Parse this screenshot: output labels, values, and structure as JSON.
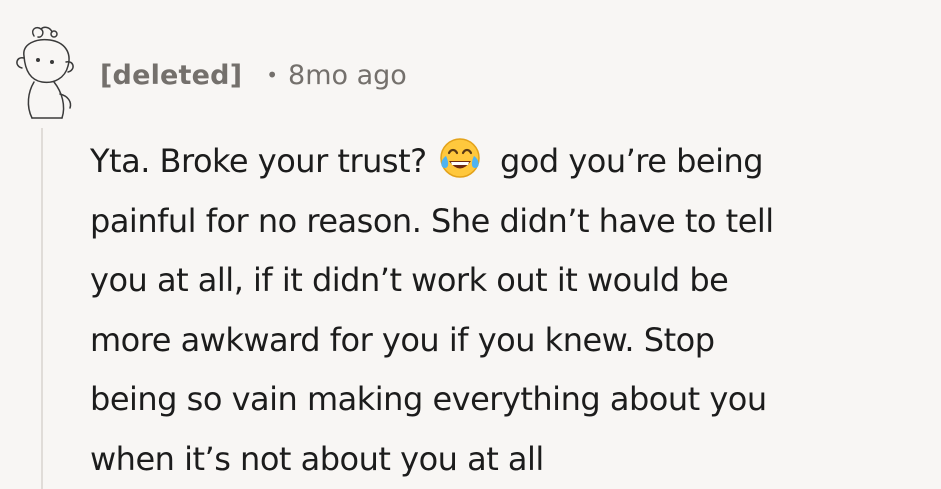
{
  "comment": {
    "author": "[deleted]",
    "separator": "•",
    "time_ago": "8mo ago",
    "body_lines": [
      "Yta. Broke your trust? ",
      " god you’re being",
      "painful for no reason. She didn’t have to tell",
      "you at all, if it didn’t work out it would be",
      "more awkward for you if you knew. Stop",
      "being so vain making everything about you",
      "when it’s not about you at all"
    ],
    "inline_emoji": "face-with-tears-of-joy-icon"
  },
  "colors": {
    "background": "#f8f6f4",
    "meta_text": "#74706c",
    "body_text": "#1c1c1c",
    "thread_line": "#e0dcd8"
  }
}
